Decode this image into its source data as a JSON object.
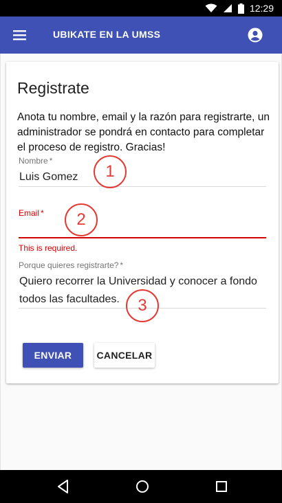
{
  "status_bar": {
    "time": "12:29"
  },
  "app_bar": {
    "title": "UBIKATE EN LA UMSS"
  },
  "form": {
    "title": "Registrate",
    "intro": "Anota tu nombre, email y la razón para registrarte, un administrador se pondrá en contacto para completar el proceso de registro. Gracias!",
    "fields": [
      {
        "label": "Nombre",
        "required_mark": "*",
        "value": "Luis Gomez",
        "error": ""
      },
      {
        "label": "Email",
        "required_mark": "*",
        "value": "",
        "error": "This is required."
      },
      {
        "label": "Porque quieres registrarte?",
        "required_mark": "*",
        "value": "Quiero recorrer la Universidad y conocer a fondo todos las facultades.",
        "error": ""
      }
    ],
    "submit_label": "ENVIAR",
    "cancel_label": "CANCELAR"
  },
  "annotations": [
    "1",
    "2",
    "3"
  ],
  "colors": {
    "primary": "#3f51b5",
    "error": "#d50000",
    "annotation": "#e53935"
  }
}
